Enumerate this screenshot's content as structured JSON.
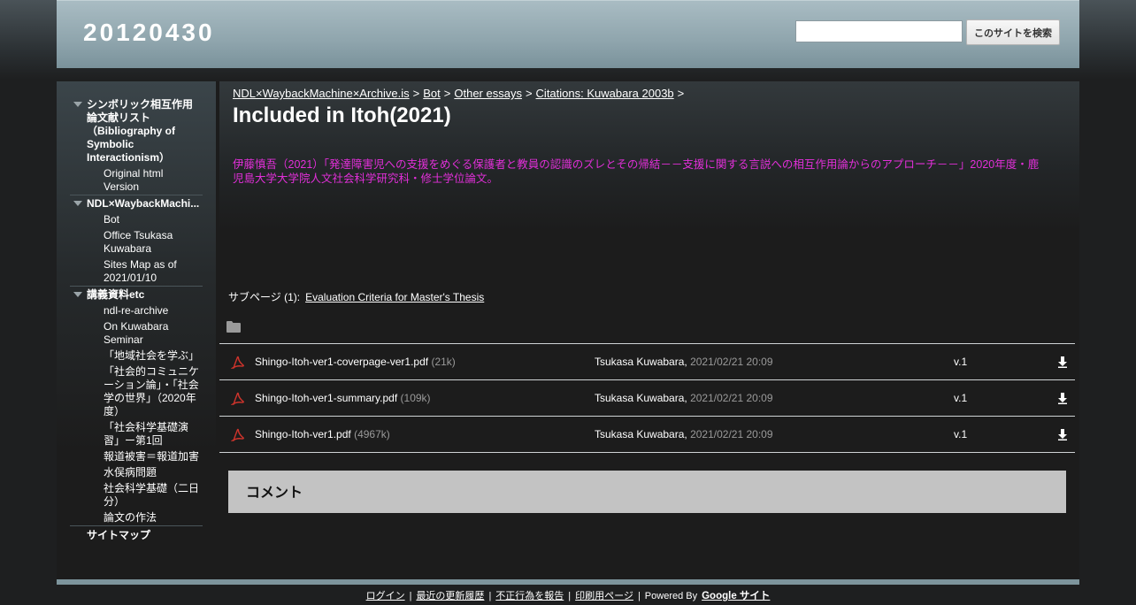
{
  "header": {
    "site_title": "20120430",
    "search_placeholder": "",
    "search_button": "このサイトを検索"
  },
  "sidebar": {
    "groups": [
      {
        "title": "シンボリック相互作用論文献リスト（Bibliography of Symbolic Interactionism）",
        "items": [
          "Original html Version"
        ]
      },
      {
        "title": "NDL×WaybackMachi...",
        "items": [
          "Bot",
          "Office Tsukasa Kuwabara",
          "Sites Map as of 2021/01/10"
        ]
      },
      {
        "title": "講義資料etc",
        "items": [
          "ndl-re-archive",
          "On Kuwabara Seminar",
          "「地域社会を学ぶ」",
          "「社会的コミュニケーション論」・「社会学の世界」（2020年度）",
          "「社会科学基礎演習」ー第1回",
          "報道被害＝報道加害",
          "水俣病問題",
          "社会科学基礎（二日分）",
          "論文の作法"
        ]
      }
    ],
    "sitemap": "サイトマップ"
  },
  "breadcrumb": {
    "items": [
      "NDL×WaybackMachine×Archive.is",
      "Bot",
      "Other essays",
      "Citations: Kuwabara 2003b"
    ],
    "separator": ">"
  },
  "page": {
    "title": "Included in Itoh(2021)",
    "body": "伊藤慎吾（2021）「発達障害児への支援をめぐる保護者と教員の認識のズレとその帰結－－支援に関する言説への相互作用論からのアプローチ－－」2020年度・鹿児島大学大学院人文社会科学研究科・修士学位論文。"
  },
  "subpages": {
    "label": "サブページ (1):",
    "link": "Evaluation Criteria for Master's Thesis"
  },
  "attachments": [
    {
      "name": "Shingo-Itoh-ver1-coverpage-ver1.pdf",
      "size": "(21k)",
      "author": "Tsukasa Kuwabara,",
      "date": "2021/02/21 20:09",
      "version": "v.1"
    },
    {
      "name": "Shingo-Itoh-ver1-summary.pdf",
      "size": "(109k)",
      "author": "Tsukasa Kuwabara,",
      "date": "2021/02/21 20:09",
      "version": "v.1"
    },
    {
      "name": "Shingo-Itoh-ver1.pdf",
      "size": "(4967k)",
      "author": "Tsukasa Kuwabara,",
      "date": "2021/02/21 20:09",
      "version": "v.1"
    }
  ],
  "comments": {
    "heading": "コメント"
  },
  "footer": {
    "login": "ログイン",
    "recent": "最近の更新履歴",
    "report": "不正行為を報告",
    "print": "印刷用ページ",
    "separator": "|",
    "powered": "Powered By",
    "google_sites": "Google サイト"
  },
  "colors": {
    "accent_text": "#e22fd9",
    "header_band": "#8fa5ad",
    "comments_bg": "#c3c3c3"
  }
}
